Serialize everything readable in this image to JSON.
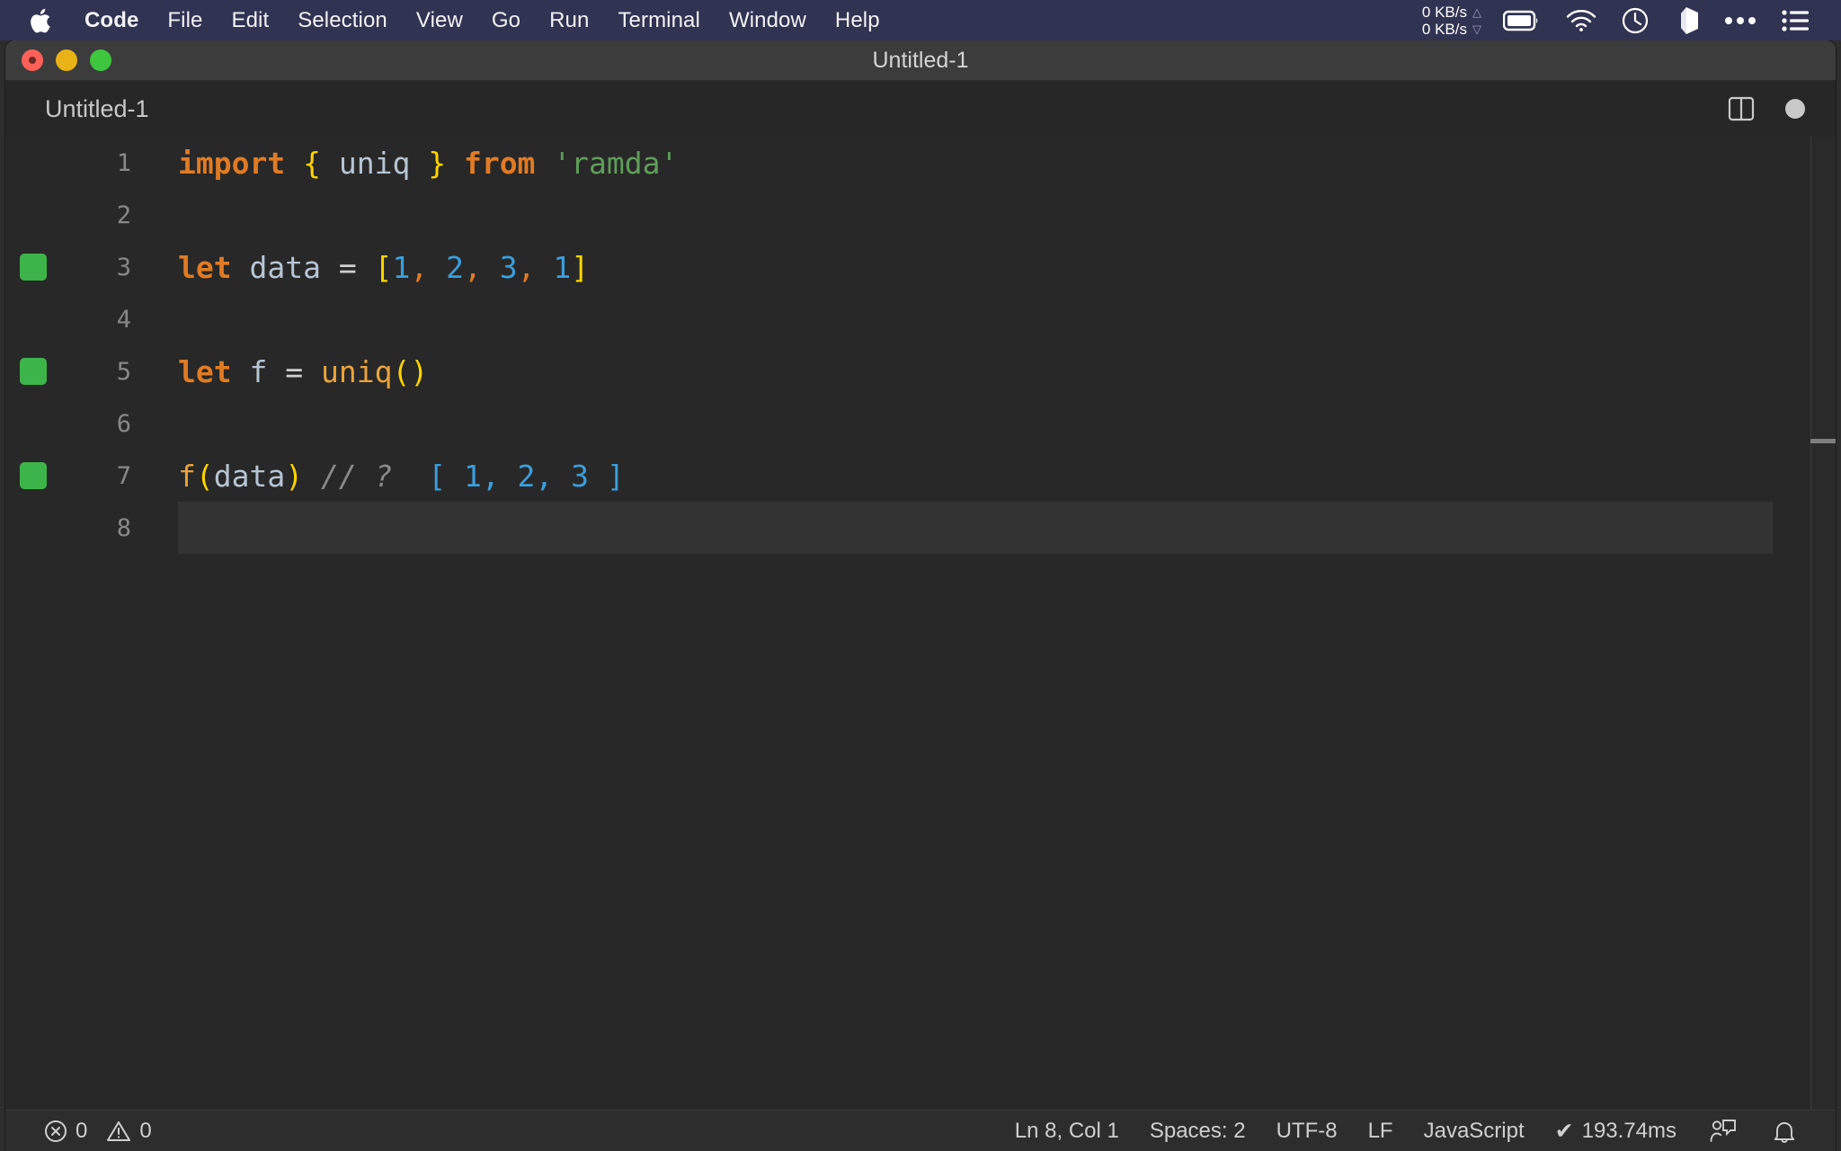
{
  "menubar": {
    "apple_icon": "apple-logo-icon",
    "items": [
      {
        "label": "Code",
        "bold": true
      },
      {
        "label": "File",
        "bold": false
      },
      {
        "label": "Edit",
        "bold": false
      },
      {
        "label": "Selection",
        "bold": false
      },
      {
        "label": "View",
        "bold": false
      },
      {
        "label": "Go",
        "bold": false
      },
      {
        "label": "Run",
        "bold": false
      },
      {
        "label": "Terminal",
        "bold": false
      },
      {
        "label": "Window",
        "bold": false
      },
      {
        "label": "Help",
        "bold": false
      }
    ],
    "network": {
      "upload": "0 KB/s",
      "download": "0 KB/s",
      "up_arrow": "triangle-up-icon",
      "down_arrow": "triangle-down-icon"
    },
    "status_icons": [
      "battery-icon",
      "wifi-icon",
      "clock-icon",
      "cube-icon",
      "ellipsis-icon",
      "list-icon"
    ],
    "background_color": "#313352"
  },
  "window": {
    "title": "Untitled-1",
    "traffic_lights": [
      "close-button",
      "minimize-button",
      "zoom-button"
    ],
    "titlebar_color": "#3c3c3c"
  },
  "tabstrip": {
    "tab_label": "Untitled-1",
    "split_editor_icon": "split-editor-icon",
    "dirty_indicator": "unsaved-dot-icon"
  },
  "editor": {
    "current_line": 8,
    "lines": [
      {
        "number": "1",
        "breakpoint": false,
        "current": false,
        "tokens": [
          {
            "t": "import",
            "c": "kw"
          },
          {
            "t": " ",
            "c": "op"
          },
          {
            "t": "{",
            "c": "brc"
          },
          {
            "t": " ",
            "c": "op"
          },
          {
            "t": "uniq",
            "c": "id"
          },
          {
            "t": " ",
            "c": "op"
          },
          {
            "t": "}",
            "c": "brc"
          },
          {
            "t": " ",
            "c": "op"
          },
          {
            "t": "from",
            "c": "kw"
          },
          {
            "t": " ",
            "c": "op"
          },
          {
            "t": "'ramda'",
            "c": "str"
          }
        ]
      },
      {
        "number": "2",
        "breakpoint": false,
        "current": false,
        "tokens": []
      },
      {
        "number": "3",
        "breakpoint": true,
        "current": false,
        "tokens": [
          {
            "t": "let",
            "c": "kw"
          },
          {
            "t": " ",
            "c": "op"
          },
          {
            "t": "data",
            "c": "id"
          },
          {
            "t": " ",
            "c": "op"
          },
          {
            "t": "=",
            "c": "op"
          },
          {
            "t": " ",
            "c": "op"
          },
          {
            "t": "[",
            "c": "brc"
          },
          {
            "t": "1",
            "c": "num"
          },
          {
            "t": ",",
            "c": "punc"
          },
          {
            "t": " ",
            "c": "op"
          },
          {
            "t": "2",
            "c": "num"
          },
          {
            "t": ",",
            "c": "punc"
          },
          {
            "t": " ",
            "c": "op"
          },
          {
            "t": "3",
            "c": "num"
          },
          {
            "t": ",",
            "c": "punc"
          },
          {
            "t": " ",
            "c": "op"
          },
          {
            "t": "1",
            "c": "num"
          },
          {
            "t": "]",
            "c": "brc"
          }
        ]
      },
      {
        "number": "4",
        "breakpoint": false,
        "current": false,
        "tokens": []
      },
      {
        "number": "5",
        "breakpoint": true,
        "current": false,
        "tokens": [
          {
            "t": "let",
            "c": "kw"
          },
          {
            "t": " ",
            "c": "op"
          },
          {
            "t": "f",
            "c": "id"
          },
          {
            "t": " ",
            "c": "op"
          },
          {
            "t": "=",
            "c": "op"
          },
          {
            "t": " ",
            "c": "op"
          },
          {
            "t": "uniq",
            "c": "fn"
          },
          {
            "t": "(",
            "c": "brc"
          },
          {
            "t": ")",
            "c": "brc"
          }
        ]
      },
      {
        "number": "6",
        "breakpoint": false,
        "current": false,
        "tokens": []
      },
      {
        "number": "7",
        "breakpoint": true,
        "current": false,
        "tokens": [
          {
            "t": "f",
            "c": "fn"
          },
          {
            "t": "(",
            "c": "brc"
          },
          {
            "t": "data",
            "c": "id"
          },
          {
            "t": ")",
            "c": "brc"
          },
          {
            "t": " ",
            "c": "op"
          },
          {
            "t": "// ?",
            "c": "cmt"
          },
          {
            "t": "  ",
            "c": "op"
          },
          {
            "t": "[ 1, 2, 3 ]",
            "c": "cmtn"
          }
        ]
      },
      {
        "number": "8",
        "breakpoint": false,
        "current": true,
        "tokens": []
      }
    ]
  },
  "statusbar": {
    "errors": "0",
    "warnings": "0",
    "error_icon": "error-circle-icon",
    "warning_icon": "warning-triangle-icon",
    "position": "Ln 8, Col 1",
    "indentation": "Spaces: 2",
    "encoding": "UTF-8",
    "eol": "LF",
    "language": "JavaScript",
    "runtime": "193.74ms",
    "runtime_check_icon": "checkmark-icon",
    "feedback_icon": "feedback-person-icon",
    "bell_icon": "bell-icon"
  },
  "colors": {
    "keyword": "#e07b24",
    "string": "#5f9e5a",
    "number": "#3b9edb",
    "bracket": "#ffd400",
    "identifier": "#b6c5d4",
    "comment": "#8a8a8a",
    "breakpoint_green": "#3cb44a",
    "editor_bg": "#282828",
    "menubar_bg": "#313352"
  }
}
